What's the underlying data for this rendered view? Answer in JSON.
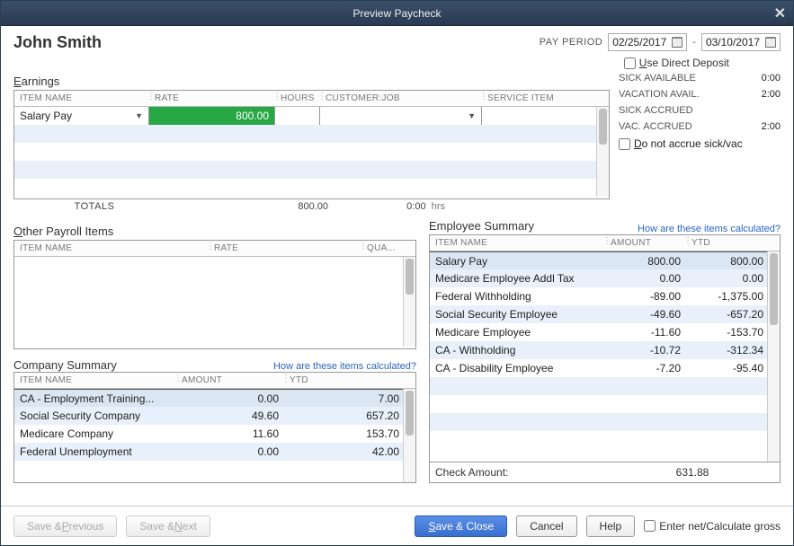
{
  "window": {
    "title": "Preview Paycheck"
  },
  "employee_name": "John Smith",
  "pay_period": {
    "label": "PAY PERIOD",
    "from": "02/25/2017",
    "to": "03/10/2017",
    "sep": "-"
  },
  "deposit": {
    "label_pre": "U",
    "label_rest": "se Direct Deposit"
  },
  "earnings": {
    "title_pre": "E",
    "title_rest": "arnings",
    "cols": {
      "c1": "ITEM NAME",
      "c2": "RATE",
      "c3": "HOURS",
      "c4": "CUSTOMER:JOB",
      "c5": "SERVICE ITEM"
    },
    "row": {
      "item": "Salary Pay",
      "rate": "800.00"
    },
    "totals": {
      "label": "TOTALS",
      "rate": "800.00",
      "hours": "0:00",
      "hrs_suffix": "hrs"
    }
  },
  "balances": {
    "sick_avail_label": "SICK AVAILABLE",
    "sick_avail": "0:00",
    "vac_avail_label": "VACATION AVAIL.",
    "vac_avail": "2:00",
    "sick_accr_label": "SICK ACCRUED",
    "sick_accr": "",
    "vac_accr_label": "VAC. ACCRUED",
    "vac_accr": "2:00",
    "noaccrue_pre": "D",
    "noaccrue_rest": "o not accrue sick/vac"
  },
  "other": {
    "title_pre": "O",
    "title_rest": "ther Payroll Items",
    "cols": {
      "c1": "ITEM NAME",
      "c2": "RATE",
      "c3": "QUA..."
    }
  },
  "company": {
    "title": "Company Summary",
    "link": "How are these items calculated?",
    "cols": {
      "c1": "ITEM NAME",
      "c2": "AMOUNT",
      "c3": "YTD"
    },
    "rows": [
      {
        "name": "CA - Employment Training...",
        "amount": "0.00",
        "ytd": "7.00"
      },
      {
        "name": "Social Security Company",
        "amount": "49.60",
        "ytd": "657.20"
      },
      {
        "name": "Medicare Company",
        "amount": "11.60",
        "ytd": "153.70"
      },
      {
        "name": "Federal Unemployment",
        "amount": "0.00",
        "ytd": "42.00"
      }
    ]
  },
  "empsum": {
    "title": "Employee Summary",
    "link": "How are these items calculated?",
    "cols": {
      "c1": "ITEM NAME",
      "c2": "AMOUNT",
      "c3": "YTD"
    },
    "rows": [
      {
        "name": "Salary Pay",
        "amount": "800.00",
        "ytd": "800.00"
      },
      {
        "name": "Medicare Employee Addl Tax",
        "amount": "0.00",
        "ytd": "0.00"
      },
      {
        "name": "Federal Withholding",
        "amount": "-89.00",
        "ytd": "-1,375.00"
      },
      {
        "name": "Social Security Employee",
        "amount": "-49.60",
        "ytd": "-657.20"
      },
      {
        "name": "Medicare Employee",
        "amount": "-11.60",
        "ytd": "-153.70"
      },
      {
        "name": "CA - Withholding",
        "amount": "-10.72",
        "ytd": "-312.34"
      },
      {
        "name": "CA - Disability Employee",
        "amount": "-7.20",
        "ytd": "-95.40"
      }
    ],
    "check_label": "Check Amount:",
    "check_amount": "631.88"
  },
  "footer": {
    "save_prev_pre": "Save & ",
    "save_prev_ul": "P",
    "save_prev_rest": "revious",
    "save_next_pre": "Save & ",
    "save_next_ul": "N",
    "save_next_rest": "ext",
    "save_close_pre": "",
    "save_close_ul": "S",
    "save_close_rest": "ave & Close",
    "cancel": "Cancel",
    "help": "Help",
    "entergross_pre": "Enter net/Calculate ",
    "entergross_ul": "g",
    "entergross_rest": "ross"
  }
}
